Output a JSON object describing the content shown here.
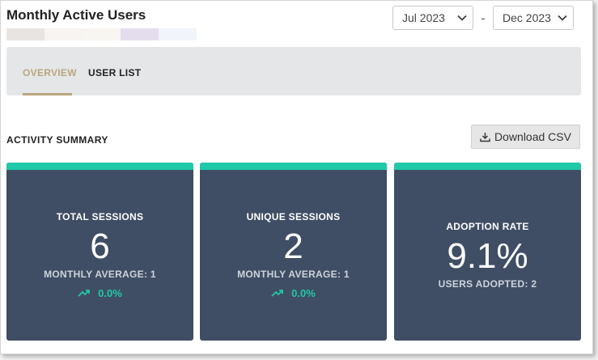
{
  "page": {
    "title": "Monthly Active Users"
  },
  "swatch_colors": [
    "#e8e4e2",
    "#f7f4f1",
    "#f8f6f0",
    "#e4dded",
    "#f1f4fa"
  ],
  "date_range": {
    "start": "Jul 2023",
    "separator": "-",
    "end": "Dec 2023"
  },
  "tabs": [
    {
      "label": "OVERVIEW",
      "active": true
    },
    {
      "label": "USER LIST",
      "active": false
    }
  ],
  "summary": {
    "heading": "ACTIVITY SUMMARY",
    "download_label": "Download CSV"
  },
  "cards": [
    {
      "label": "TOTAL SESSIONS",
      "value": "6",
      "sub": "MONTHLY AVERAGE: 1",
      "trend": "0.0%"
    },
    {
      "label": "UNIQUE SESSIONS",
      "value": "2",
      "sub": "MONTHLY AVERAGE: 1",
      "trend": "0.0%"
    },
    {
      "label": "ADOPTION RATE",
      "value": "9.1%",
      "sub": "USERS ADOPTED: 2"
    }
  ],
  "colors": {
    "accent_gold": "#b9a77e",
    "accent_teal": "#20c9a8",
    "card_bg": "#3f4e64"
  },
  "icons": {
    "download": "download-icon",
    "trend": "trend-up-icon",
    "dropdown": "chevron-down-icon"
  }
}
